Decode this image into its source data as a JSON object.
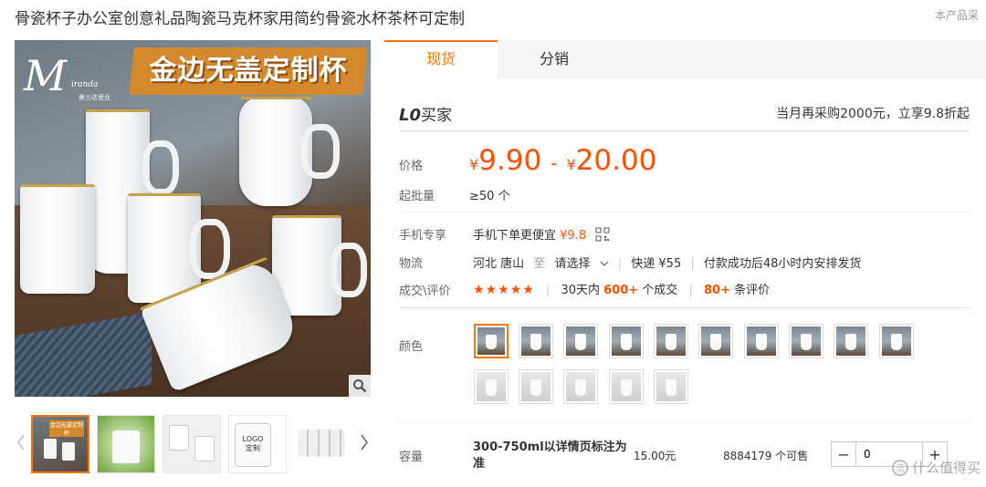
{
  "product": {
    "title": "骨瓷杯子办公室创意礼品陶瓷马克杯家用简约骨瓷水杯茶杯可定制",
    "corner_note": "本产品采"
  },
  "gallery": {
    "banner_text": "金边无盖定制杯",
    "brand_initial": "M",
    "brand_name": "iranda",
    "brand_sub": "美兰达瓷业",
    "thumb_logo_text": "LOGO\n定制",
    "thumb_banner_text": "金边无盖定制杯"
  },
  "tabs": [
    {
      "label": "现货"
    },
    {
      "label": "分销"
    }
  ],
  "buyer": {
    "badge": "L0",
    "label": "买家",
    "deal": "当月再采购2000元，立享9.8折起"
  },
  "price": {
    "label": "价格",
    "currency": "¥",
    "low": "9.90",
    "high": "20.00",
    "separator": "-"
  },
  "moq": {
    "label": "起批量",
    "value": "≥50 个"
  },
  "mobile": {
    "label": "手机专享",
    "text": "手机下单更便宜",
    "price": "¥9.8"
  },
  "logistics": {
    "label": "物流",
    "origin": "河北 唐山",
    "to": "至",
    "dest": "请选择",
    "express": "快递 ¥55",
    "ship_note": "付款成功后48小时内安排发货"
  },
  "reviews": {
    "label": "成交\\评价",
    "stars": "★★★★★",
    "period": "30天内",
    "deals": "600+",
    "deals_unit": "个成交",
    "reviews_count": "80+",
    "reviews_unit": "条评价"
  },
  "color": {
    "label": "颜色"
  },
  "capacity": {
    "label": "容量",
    "name": "300-750ml以详情页标注为准",
    "price": "15.00元",
    "stock": "8884179 个可售",
    "qty": "0",
    "minus": "−",
    "plus": "+"
  },
  "watermark": {
    "text": "什么值得买",
    "mark": "值"
  },
  "colors": {
    "accent": "#ff7300",
    "price": "#ff5000"
  }
}
